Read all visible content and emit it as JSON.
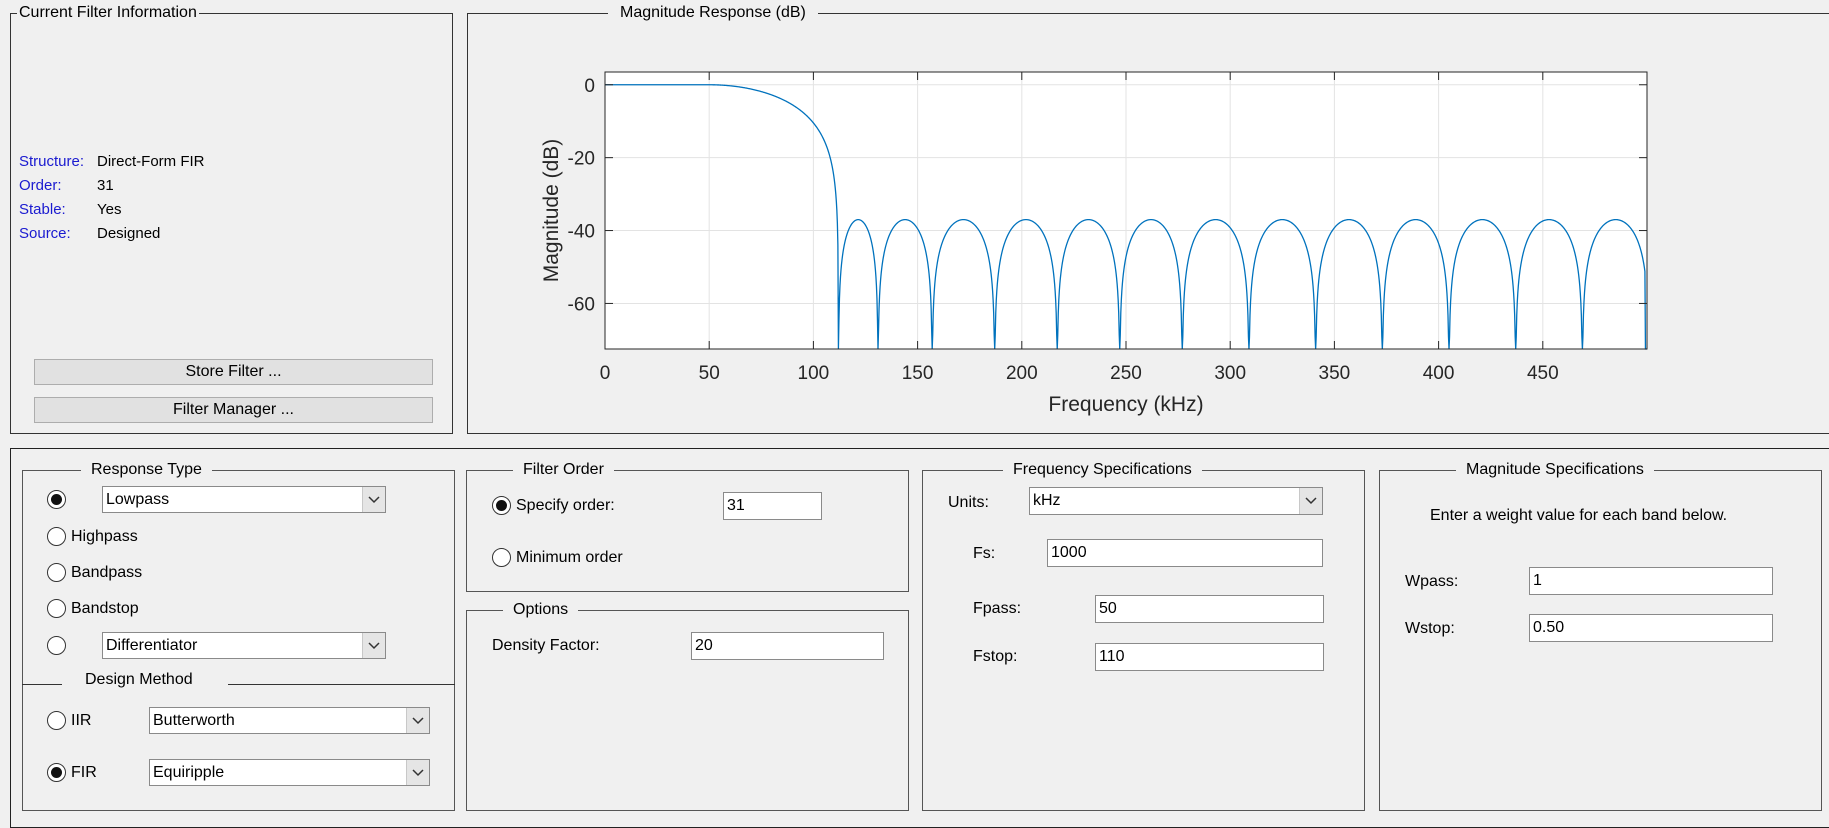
{
  "filter_info": {
    "title": "Current Filter Information",
    "rows": [
      {
        "key": "Structure:",
        "value": "Direct-Form FIR"
      },
      {
        "key": "Order:",
        "value": "31"
      },
      {
        "key": "Stable:",
        "value": "Yes"
      },
      {
        "key": "Source:",
        "value": "Designed"
      }
    ],
    "store_button": "Store Filter ...",
    "manager_button": "Filter Manager ..."
  },
  "magnitude_panel": {
    "title": "Magnitude Response (dB)"
  },
  "chart_data": {
    "type": "line",
    "title": "",
    "xlabel": "Frequency (kHz)",
    "ylabel": "Magnitude (dB)",
    "xlim": [
      0,
      500
    ],
    "ylim": [
      -72.5,
      3.5
    ],
    "x_ticks": [
      "0",
      "50",
      "100",
      "150",
      "200",
      "250",
      "300",
      "350",
      "400",
      "450"
    ],
    "y_ticks": [
      "0",
      "-20",
      "-40",
      "-60"
    ],
    "grid": true,
    "line_color": "#0072bd",
    "series": [
      {
        "passband_edge_khz": 50,
        "passband_level_db": 0,
        "stopband_peak_db": -37,
        "zeros_khz": [
          112,
          131,
          157,
          187,
          217,
          247,
          277,
          309,
          341,
          373,
          405,
          437,
          469
        ],
        "start_level_db": 0,
        "end_level_db": -72.5
      }
    ]
  },
  "response_type": {
    "title": "Response Type",
    "options": [
      {
        "label": "Lowpass",
        "selected": true,
        "dropdown": true
      },
      {
        "label": "Highpass",
        "selected": false,
        "dropdown": false
      },
      {
        "label": "Bandpass",
        "selected": false,
        "dropdown": false
      },
      {
        "label": "Bandstop",
        "selected": false,
        "dropdown": false
      },
      {
        "label": "Differentiator",
        "selected": false,
        "dropdown": true
      }
    ]
  },
  "design_method": {
    "title": "Design Method",
    "iir_label": "IIR",
    "iir_value": "Butterworth",
    "fir_label": "FIR",
    "fir_value": "Equiripple",
    "selected": "FIR"
  },
  "filter_order": {
    "title": "Filter Order",
    "specify_label": "Specify order:",
    "specify_value": "31",
    "minimum_label": "Minimum order",
    "selected": "specify"
  },
  "options": {
    "title": "Options",
    "density_label": "Density Factor:",
    "density_value": "20"
  },
  "frequency_specs": {
    "title": "Frequency Specifications",
    "units_label": "Units:",
    "units_value": "kHz",
    "fs_label": "Fs:",
    "fs_value": "1000",
    "fpass_label": "Fpass:",
    "fpass_value": "50",
    "fstop_label": "Fstop:",
    "fstop_value": "110"
  },
  "magnitude_specs": {
    "title": "Magnitude Specifications",
    "instruction": "Enter a weight value for each band below.",
    "wpass_label": "Wpass:",
    "wpass_value": "1",
    "wstop_label": "Wstop:",
    "wstop_value": "0.50"
  }
}
